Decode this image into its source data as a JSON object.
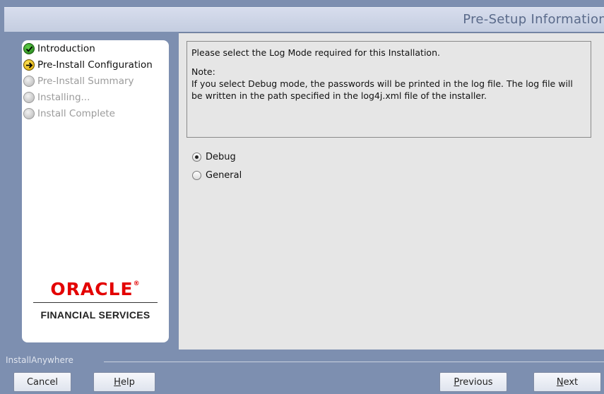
{
  "header": {
    "title": "Pre-Setup Information"
  },
  "steps": [
    {
      "label": "Introduction",
      "state": "done"
    },
    {
      "label": "Pre-Install Configuration",
      "state": "current"
    },
    {
      "label": "Pre-Install Summary",
      "state": "todo"
    },
    {
      "label": "Installing...",
      "state": "todo"
    },
    {
      "label": "Install Complete",
      "state": "todo"
    }
  ],
  "logo": {
    "brand": "ORACLE",
    "registered": "®",
    "subtitle": "FINANCIAL SERVICES"
  },
  "main": {
    "instruction": "Please select the Log Mode required for this Installation.",
    "note_heading": "Note:",
    "note_text": "If you select Debug mode, the passwords will be printed in the log file. The log file will be written in the path specified in the log4j.xml file of the installer.",
    "options": [
      {
        "label": "Debug",
        "selected": true
      },
      {
        "label": "General",
        "selected": false
      }
    ]
  },
  "footer": {
    "vendor": "InstallAnywhere",
    "buttons": {
      "cancel": {
        "label": "Cancel"
      },
      "help": {
        "mnemonic": "H",
        "rest": "elp"
      },
      "previous": {
        "mnemonic": "P",
        "rest": "revious"
      },
      "next": {
        "mnemonic": "N",
        "rest": "ext"
      }
    }
  },
  "colors": {
    "window_bg": "#7d8fb0",
    "banner_bg": "#c4cde0",
    "content_bg": "#e6e6e6",
    "brand_red": "#e30000"
  }
}
